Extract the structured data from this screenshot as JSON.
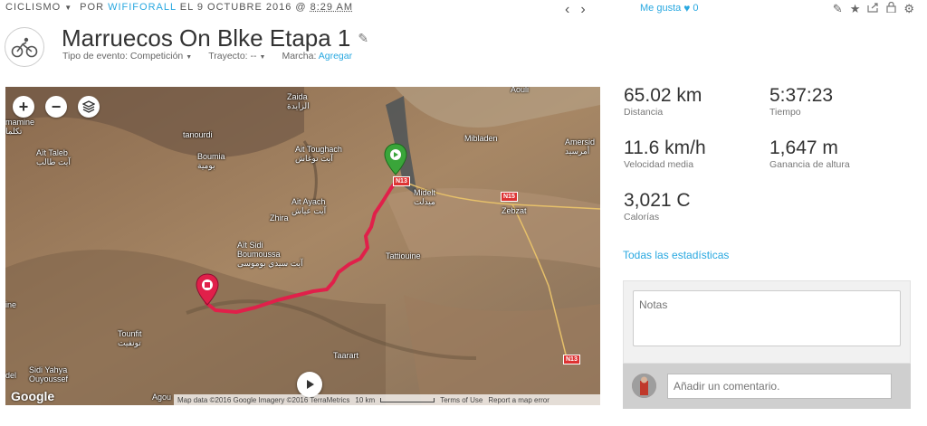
{
  "header": {
    "activity_type": "CICLISMO",
    "by_prefix": "POR",
    "user": "WIFIFORALL",
    "date_prefix": "EL 9 OCTUBRE 2016 @",
    "time": "8:29 AM",
    "nav_prev": "‹",
    "nav_next": "›",
    "likes_label": "Me gusta",
    "likes_count": "0"
  },
  "activity": {
    "title": "Marruecos On Blke Etapa 1",
    "event_type_label": "Tipo de evento: Competición",
    "course_label": "Trayecto: --",
    "gear_label": "Marcha:",
    "gear_action": "Agregar"
  },
  "map": {
    "zoom_in": "+",
    "zoom_out": "−",
    "places": {
      "zaida": "Zaida",
      "zaida_ar": "الزايدة",
      "aouli": "Aouli",
      "mibladen": "Mibladen",
      "amersid": "Amersid",
      "amersid_ar": "أمرسيد",
      "tanourdi": "tanourdi",
      "boumia": "Boumia",
      "boumia_ar": "بومية",
      "ait_toughach": "Ait Toughach",
      "ait_toughach_ar": "آيت توغاش",
      "ait_taleb": "Aït Taleb",
      "ait_taleb_ar": "آيت طالب",
      "amamine": "mamine",
      "amamine_ar": "تكلما",
      "ait_ayach": "Ait Ayach",
      "ait_ayach_ar": "آيت عياش",
      "zhira": "Zhira",
      "midelt": "Midelt",
      "midelt_ar": "ميدلت",
      "zebzat": "Zebzat",
      "ait_sidi": "Aït Sidi",
      "ait_sidi2": "Boumoussa",
      "ait_sidi_ar": "آيت سيدي بوموسى",
      "tattiouine": "Tattiouine",
      "tounfit": "Tounfit",
      "tounfit_ar": "تونفيت",
      "taarart": "Taarart",
      "sidi_yahya": "Sidi Yahya",
      "sidi_yahya2": "Ouyoussef",
      "agoud": "Agou",
      "ine": "ine",
      "del": "del"
    },
    "roads": {
      "n13a": "N13",
      "n15": "N15",
      "n13b": "N13"
    },
    "google": "Google",
    "attribution": "Map data ©2016 Google Imagery ©2016 TerraMetrics",
    "scale_label": "10 km",
    "terms": "Terms of Use",
    "report": "Report a map error"
  },
  "stats": {
    "distance_value": "65.02 km",
    "distance_label": "Distancia",
    "time_value": "5:37:23",
    "time_label": "Tiempo",
    "speed_value": "11.6 km/h",
    "speed_label": "Velocidad media",
    "elevation_value": "1,647 m",
    "elevation_label": "Ganancia de altura",
    "calories_value": "3,021 C",
    "calories_label": "Calorías",
    "all_stats": "Todas las estadísticas"
  },
  "notes": {
    "placeholder": "Notas"
  },
  "comment": {
    "placeholder": "Añadir un comentario."
  },
  "colors": {
    "accent": "#29a8e0",
    "route": "#e0204a",
    "start_marker": "#3aa53a",
    "end_marker": "#e0204a"
  }
}
